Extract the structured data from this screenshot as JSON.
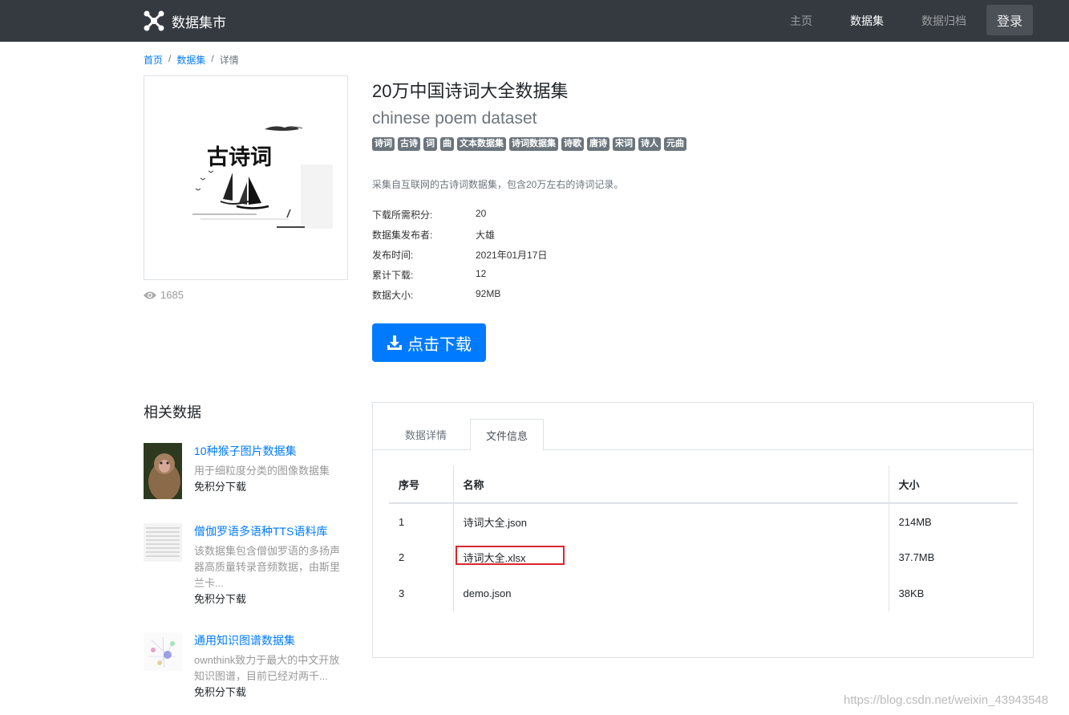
{
  "navbar": {
    "brand": "数据集市",
    "links": [
      "主页",
      "数据集",
      "数据归档"
    ],
    "active": "数据集",
    "login": "登录"
  },
  "breadcrumb": [
    "首页",
    "数据集",
    "详情"
  ],
  "cover": {
    "image_text": "古诗词",
    "views": "1685"
  },
  "dataset": {
    "title": "20万中国诗词大全数据集",
    "subtitle": "chinese poem dataset",
    "tags": [
      "诗词",
      "古诗",
      "词",
      "曲",
      "文本数据集",
      "诗词数据集",
      "诗歌",
      "唐诗",
      "宋词",
      "诗人",
      "元曲"
    ],
    "description": "采集自互联网的古诗词数据集，包含20万左右的诗词记录。",
    "meta": [
      {
        "label": "下载所需积分:",
        "value": "20"
      },
      {
        "label": "数据集发布者:",
        "value": "大雄"
      },
      {
        "label": "发布时间:",
        "value": "2021年01月17日"
      },
      {
        "label": "累计下载:",
        "value": "12"
      },
      {
        "label": "数据大小:",
        "value": "92MB"
      }
    ],
    "download_label": "点击下载"
  },
  "related": {
    "title": "相关数据",
    "items": [
      {
        "name": "10种猴子图片数据集",
        "desc": "用于细粒度分类的图像数据集",
        "tag": "免积分下载"
      },
      {
        "name": "僧伽罗语多语种TTS语料库",
        "desc": "该数据集包含僧伽罗语的多扬声器高质量转录音频数据，由斯里兰卡...",
        "tag": "免积分下载"
      },
      {
        "name": "通用知识图谱数据集",
        "desc": "ownthink致力于最大的中文开放知识图谱，目前已经对两千...",
        "tag": "免积分下载"
      }
    ]
  },
  "tabs": [
    "数据详情",
    "文件信息"
  ],
  "active_tab": "文件信息",
  "files": {
    "headers": [
      "序号",
      "名称",
      "大小"
    ],
    "rows": [
      [
        "1",
        "诗词大全.json",
        "214MB"
      ],
      [
        "2",
        "诗词大全.xlsx",
        "37.7MB"
      ],
      [
        "3",
        "demo.json",
        "38KB"
      ]
    ]
  },
  "watermark": "https://blog.csdn.net/weixin_43943548",
  "colors": {
    "navbar": "#343a40",
    "primary": "#007bff",
    "highlight": "#d9262c"
  }
}
